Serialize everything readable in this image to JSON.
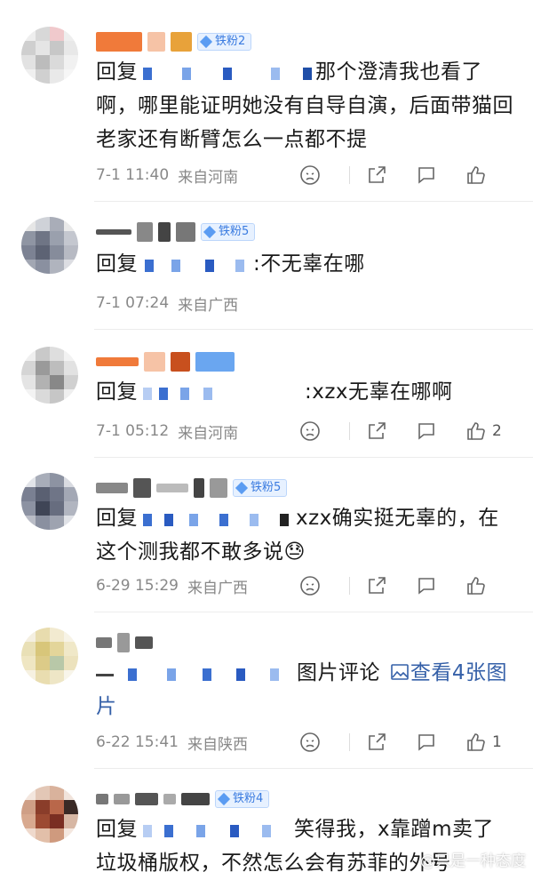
{
  "comments": [
    {
      "badge": "铁粉2",
      "reply_prefix": "回复",
      "text_after": "那个澄清我也看了啊，哪里能证明她没有自导自演，后面带猫回老家还有断臂怎么一点都不提",
      "time": "7-1 11:40",
      "location": "来自河南",
      "likes": ""
    },
    {
      "badge": "铁粉5",
      "reply_prefix": "回复",
      "text_after": ":不无辜在哪",
      "time": "7-1 07:24",
      "location": "来自广西",
      "likes": ""
    },
    {
      "badge": "",
      "reply_prefix": "回复",
      "text_after": ":xzx无辜在哪啊",
      "time": "7-1 05:12",
      "location": "来自河南",
      "likes": "2"
    },
    {
      "badge": "铁粉5",
      "reply_prefix": "回复",
      "text_after": "xzx确实挺无辜的，在这个测我都不敢多说😓",
      "time": "6-29 15:29",
      "location": "来自广西",
      "likes": ""
    },
    {
      "badge": "",
      "reply_prefix": "",
      "text_after": "图片评论",
      "link_text": "查看4张图片",
      "time": "6-22 15:41",
      "location": "来自陕西",
      "likes": "1"
    },
    {
      "badge": "铁粉4",
      "reply_prefix": "回复",
      "text_after": "笑得我，x靠蹭m卖了垃圾桶版权，不然怎么会有苏菲的外号",
      "time": "",
      "location": "",
      "likes": ""
    }
  ],
  "watermark": "@只是一种态度",
  "icons": [
    "dislike-icon",
    "share-icon",
    "comment-icon",
    "like-icon",
    "image-icon"
  ],
  "colors": {
    "badge": "#3a7be0",
    "link": "#3560a8",
    "meta": "#888888"
  }
}
